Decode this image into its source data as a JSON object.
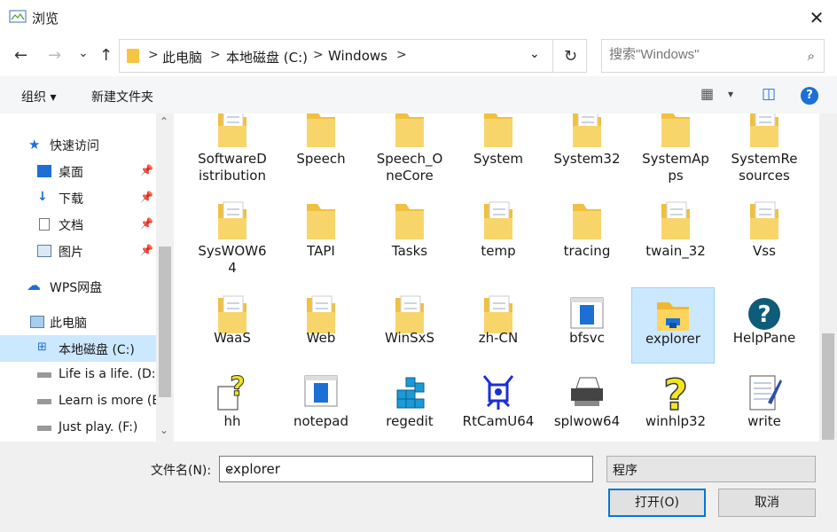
{
  "window": {
    "title": "浏览",
    "close_glyph": "✕"
  },
  "nav_buttons": {
    "back": "←",
    "forward": "→",
    "recent": "⌄",
    "up": "↑"
  },
  "address": {
    "crumbs": [
      "此电脑",
      "本地磁盘 (C:)",
      "Windows"
    ],
    "separator": ">",
    "dropdown": "⌄",
    "refresh": "↻"
  },
  "search": {
    "placeholder": "搜索\"Windows\"",
    "icon": "⌕"
  },
  "toolbar": {
    "organize": "组织 ▾",
    "new_folder": "新建文件夹",
    "view_icon": "▦",
    "view_dd": "▾",
    "pane_icon": "◫",
    "help": "?"
  },
  "sidebar": {
    "items": [
      {
        "label": "快速访问"
      },
      {
        "label": "桌面",
        "pinned": "📌"
      },
      {
        "label": "下载",
        "pinned": "📌"
      },
      {
        "label": "文档",
        "pinned": "📌"
      },
      {
        "label": "图片",
        "pinned": "📌"
      },
      {
        "label": "WPS网盘"
      },
      {
        "label": "此电脑"
      },
      {
        "label": "本地磁盘 (C:)"
      },
      {
        "label": "Life is a life. (D:)"
      },
      {
        "label": "Learn is more (E:)"
      },
      {
        "label": "Just play. (F:)"
      }
    ],
    "scroll_up": "⌃",
    "scroll_down": "⌄"
  },
  "files": [
    {
      "name": "SoftwareDistribution",
      "display": "SoftwareD\nistribution",
      "kind": "folder-doc"
    },
    {
      "name": "Speech",
      "display": "Speech",
      "kind": "folder"
    },
    {
      "name": "Speech_OneCore",
      "display": "Speech_O\nneCore",
      "kind": "folder"
    },
    {
      "name": "System",
      "display": "System",
      "kind": "folder"
    },
    {
      "name": "System32",
      "display": "System32",
      "kind": "folder-doc"
    },
    {
      "name": "SystemApps",
      "display": "SystemAp\nps",
      "kind": "folder"
    },
    {
      "name": "SystemResources",
      "display": "SystemRe\nsources",
      "kind": "folder-doc"
    },
    {
      "name": "SysWOW64",
      "display": "SysWOW6\n4",
      "kind": "folder-doc"
    },
    {
      "name": "TAPI",
      "display": "TAPI",
      "kind": "folder"
    },
    {
      "name": "Tasks",
      "display": "Tasks",
      "kind": "folder"
    },
    {
      "name": "temp",
      "display": "temp",
      "kind": "folder-doc"
    },
    {
      "name": "tracing",
      "display": "tracing",
      "kind": "folder"
    },
    {
      "name": "twain_32",
      "display": "twain_32",
      "kind": "folder-doc"
    },
    {
      "name": "Vss",
      "display": "Vss",
      "kind": "folder-doc"
    },
    {
      "name": "WaaS",
      "display": "WaaS",
      "kind": "folder-doc"
    },
    {
      "name": "Web",
      "display": "Web",
      "kind": "folder-doc"
    },
    {
      "name": "WinSxS",
      "display": "WinSxS",
      "kind": "folder-doc"
    },
    {
      "name": "zh-CN",
      "display": "zh-CN",
      "kind": "folder-doc"
    },
    {
      "name": "bfsvc",
      "display": "bfsvc",
      "kind": "app-window"
    },
    {
      "name": "explorer",
      "display": "explorer",
      "kind": "explorer",
      "selected": true
    },
    {
      "name": "HelpPane",
      "display": "HelpPane",
      "kind": "help-circle"
    },
    {
      "name": "hh",
      "display": "hh",
      "kind": "help-doc"
    },
    {
      "name": "notepad",
      "display": "notepad",
      "kind": "app-window"
    },
    {
      "name": "regedit",
      "display": "regedit",
      "kind": "regedit"
    },
    {
      "name": "RtCamU64",
      "display": "RtCamU64",
      "kind": "realtek"
    },
    {
      "name": "splwow64",
      "display": "splwow64",
      "kind": "printer"
    },
    {
      "name": "winhlp32",
      "display": "winhlp32",
      "kind": "help-question"
    },
    {
      "name": "write",
      "display": "write",
      "kind": "write"
    }
  ],
  "bottom": {
    "filename_label": "文件名(N):",
    "filename_value": "explorer",
    "filename_dd": "⌄",
    "filetype_value": "程序",
    "filetype_dd": "⌄",
    "open_label": "打开(O)",
    "cancel_label": "取消"
  },
  "colors": {
    "accent": "#0078d7",
    "selection": "#cce8ff",
    "folder": "#f5c542",
    "help_blue": "#1c6fd4"
  }
}
